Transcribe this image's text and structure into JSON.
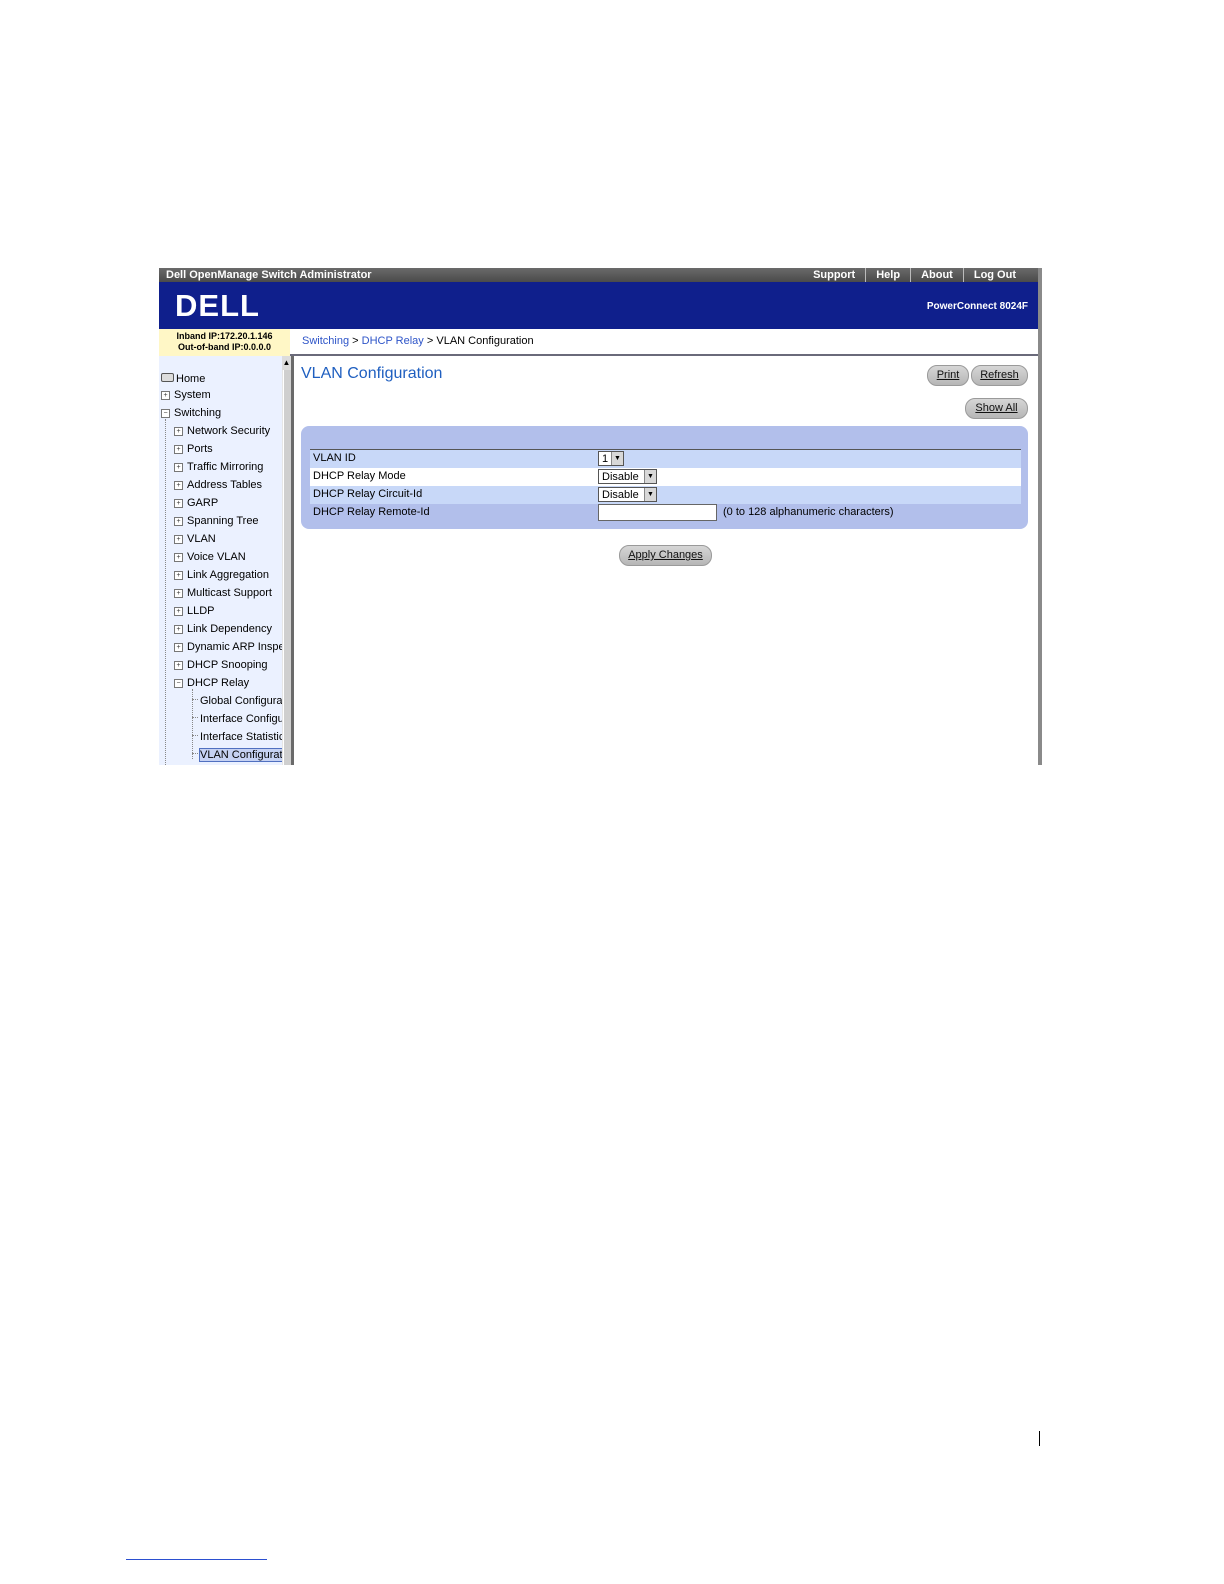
{
  "titlebar": {
    "app_title": "Dell OpenManage Switch Administrator",
    "links": [
      "Support",
      "Help",
      "About",
      "Log Out"
    ]
  },
  "banner": {
    "logo": "DELL",
    "model": "PowerConnect 8024F"
  },
  "ip_info": {
    "inband": "Inband IP:172.20.1.146",
    "outofband": "Out-of-band IP:0.0.0.0"
  },
  "breadcrumb": {
    "items": [
      "Switching",
      "DHCP Relay"
    ],
    "current": "VLAN Configuration",
    "separator": ">"
  },
  "sidebar": {
    "home": "Home",
    "system": "System",
    "switching": "Switching",
    "children": [
      "Network Security",
      "Ports",
      "Traffic Mirroring",
      "Address Tables",
      "GARP",
      "Spanning Tree",
      "VLAN",
      "Voice VLAN",
      "Link Aggregation",
      "Multicast Support",
      "LLDP",
      "Link Dependency",
      "Dynamic ARP Inspe",
      "DHCP Snooping"
    ],
    "dhcp_relay": "DHCP Relay",
    "dhcp_relay_children": [
      "Global Configurat",
      "Interface Configu",
      "Interface Statistic",
      "VLAN Configurati"
    ]
  },
  "main": {
    "title": "VLAN Configuration",
    "print": "Print",
    "refresh": "Refresh",
    "show_all": "Show All",
    "apply": "Apply Changes"
  },
  "form": {
    "vlan_id_label": "VLAN ID",
    "vlan_id_value": "1",
    "relay_mode_label": "DHCP Relay Mode",
    "relay_mode_value": "Disable",
    "circuit_id_label": "DHCP Relay Circuit-Id",
    "circuit_id_value": "Disable",
    "remote_id_label": "DHCP Relay Remote-Id",
    "remote_id_value": "",
    "remote_id_hint": "(0 to 128 alphanumeric characters)"
  }
}
